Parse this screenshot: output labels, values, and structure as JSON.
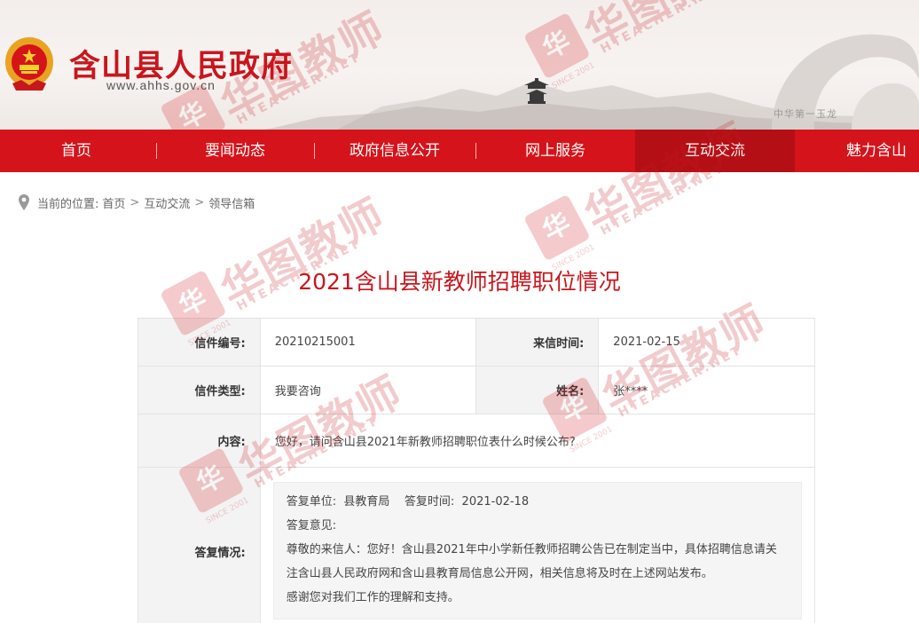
{
  "header": {
    "site_title": "含山县人民政府",
    "site_url": "www.ahhs.gov.cn",
    "banner_caption": "中华第一玉龙"
  },
  "nav": {
    "items": [
      {
        "label": "首页"
      },
      {
        "label": "要闻动态"
      },
      {
        "label": "政府信息公开"
      },
      {
        "label": "网上服务"
      },
      {
        "label": "互动交流"
      },
      {
        "label": "魅力含山"
      }
    ],
    "active_index": 4
  },
  "breadcrumb": {
    "prefix": "当前的位置:",
    "items": [
      "首页",
      "互动交流",
      "领导信箱"
    ],
    "separator": ">"
  },
  "page": {
    "title": "2021含山县新教师招聘职位情况"
  },
  "letter": {
    "number_label": "信件编号:",
    "number_value": "20210215001",
    "time_label": "来信时间:",
    "time_value": "2021-02-15",
    "type_label": "信件类型:",
    "type_value": "我要咨询",
    "name_label": "姓名:",
    "name_value": "张****",
    "content_label": "内容:",
    "content_value": "您好，请问含山县2021年新教师招聘职位表什么时候公布?",
    "reply_label": "答复情况:",
    "reply": {
      "unit_line": "答复单位:  县教育局    答复时间:  2021-02-18",
      "opinion_label": "答复意见:",
      "body_line1": "尊敬的来信人：您好！含山县2021年中小学新任教师招聘公告已在制定当中，具体招聘信息请关",
      "body_line2": "注含山县人民政府网和含山县教育局信息公开网，相关信息将及时在上述网站发布。",
      "closing": "感谢您对我们工作的理解和支持。"
    }
  },
  "watermark": {
    "badge": "华",
    "text": "华图教师",
    "sub": "HTEACHER.NET",
    "since": "SINCE 2001"
  },
  "colors": {
    "brand_red": "#d5131a",
    "title_red": "#c8161d",
    "nav_active": "#b40f15"
  }
}
